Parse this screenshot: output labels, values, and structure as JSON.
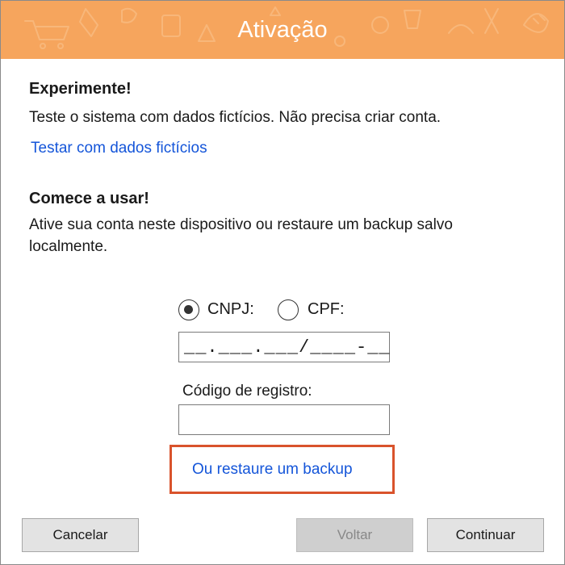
{
  "window": {
    "title": "Ativação"
  },
  "experiment": {
    "heading": "Experimente!",
    "description": "Teste o sistema com dados fictícios. Não precisa criar conta.",
    "link": "Testar com dados fictícios"
  },
  "start": {
    "heading": "Comece a usar!",
    "description": "Ative sua conta neste dispositivo ou restaure um backup salvo localmente."
  },
  "document_type": {
    "options": [
      {
        "label": "CNPJ:",
        "selected": true
      },
      {
        "label": "CPF:",
        "selected": false
      }
    ],
    "mask": "__.___.___/____-__"
  },
  "registration": {
    "label": "Código de registro:",
    "value": ""
  },
  "restore_link": "Ou restaure um backup",
  "buttons": {
    "cancel": "Cancelar",
    "back": "Voltar",
    "continue": "Continuar"
  },
  "colors": {
    "title_bar": "#f6a55d",
    "link": "#1455d9",
    "highlight": "#d9532c"
  }
}
